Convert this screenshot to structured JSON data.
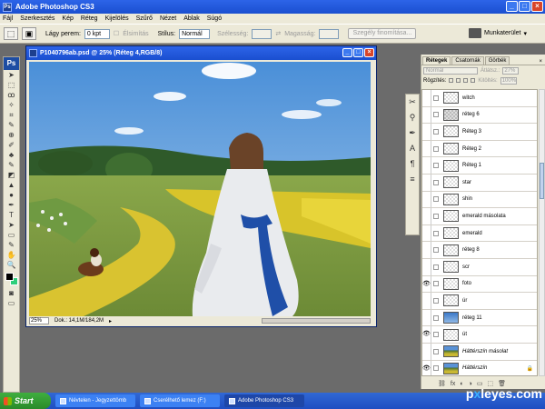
{
  "app": {
    "title": "Adobe Photoshop CS3",
    "icon_text": "Ps"
  },
  "window_controls": [
    "_",
    "□",
    "×"
  ],
  "menu": [
    "Fájl",
    "Szerkesztés",
    "Kép",
    "Réteg",
    "Kijelölés",
    "Szűrő",
    "Nézet",
    "Ablak",
    "Súgó"
  ],
  "options": {
    "feather_label": "Lágy perem:",
    "feather_value": "0 kpt",
    "antialias_label": "Élsimítás",
    "style_label": "Stílus:",
    "style_value": "Normál",
    "width_label": "Szélesség:",
    "height_label": "Magasság:",
    "refine_button": "Szegély finomítása...",
    "workspace_label": "Munkaterület",
    "swap_glyph": "⇄"
  },
  "tools": {
    "logo": "Ps",
    "glyphs": [
      "➤",
      "⬚",
      "ꝏ",
      "✧",
      "⌗",
      "✎",
      "⊕",
      "✐",
      "♣",
      "✎",
      "◩",
      "▲",
      "●",
      "✒",
      "T",
      "➤",
      "▭",
      "✎",
      "✋",
      "🔍"
    ],
    "foreground_color": "#000000",
    "background_color": "#2ecf7a"
  },
  "document": {
    "title": "P1040796ab.psd @ 25% (Réteg 4,RGB/8)",
    "zoom": "25%",
    "doc_size": "Dok.: 14,1M/184,2M",
    "status_arrow": "▸"
  },
  "mini_panel_glyphs": [
    "✂",
    "⚲",
    "✒",
    "A",
    "¶",
    "≡"
  ],
  "layers_panel": {
    "tabs": [
      "Rétegek",
      "Csatornák",
      "Görbék"
    ],
    "active_tab": 0,
    "close_glyph": "×",
    "blend_mode": "Normál",
    "opacity_label": "Átlátsz.:",
    "opacity_value": "27%",
    "lock_label": "Rögzítés:",
    "fill_label": "Kitöltés:",
    "fill_value": "100%",
    "eye_glyph": "👁",
    "lock_glyph": "🔒",
    "bottom_icons": [
      "⛓",
      "fx",
      "◐",
      "◑",
      "▭",
      "⬚",
      "🗑"
    ],
    "layers": [
      {
        "name": "witch",
        "visible": false,
        "thumb": "checker"
      },
      {
        "name": "réteg 6",
        "visible": false,
        "thumb": "checker-dark"
      },
      {
        "name": "Réteg 3",
        "visible": false,
        "thumb": "checker"
      },
      {
        "name": "Réteg 2",
        "visible": false,
        "thumb": "checker"
      },
      {
        "name": "Réteg 1",
        "visible": false,
        "thumb": "checker"
      },
      {
        "name": "star",
        "visible": false,
        "thumb": "checker"
      },
      {
        "name": "shin",
        "visible": false,
        "thumb": "checker"
      },
      {
        "name": "emerald másolata",
        "visible": false,
        "thumb": "checker"
      },
      {
        "name": "emerald",
        "visible": false,
        "thumb": "checker"
      },
      {
        "name": "réteg 8",
        "visible": false,
        "thumb": "checker"
      },
      {
        "name": "scr",
        "visible": false,
        "thumb": "checker"
      },
      {
        "name": "foto",
        "visible": true,
        "thumb": "checker"
      },
      {
        "name": "úr",
        "visible": false,
        "thumb": "checker"
      },
      {
        "name": "réteg 11",
        "visible": false,
        "thumb": "sky"
      },
      {
        "name": "út",
        "visible": true,
        "thumb": "checker"
      },
      {
        "name": "Háttérszín másolat",
        "visible": false,
        "thumb": "photo"
      },
      {
        "name": "Háttérszín",
        "visible": true,
        "thumb": "photo",
        "locked": true
      }
    ]
  },
  "taskbar": {
    "start": "Start",
    "tasks": [
      "Névtelen - Jegyzettömb",
      "Cserélhető lemez (F:)",
      "Adobe Photoshop CS3"
    ],
    "active_task": 2
  },
  "watermark": {
    "text_a": "p",
    "text_x": "x",
    "text_b": "leyes.com"
  }
}
